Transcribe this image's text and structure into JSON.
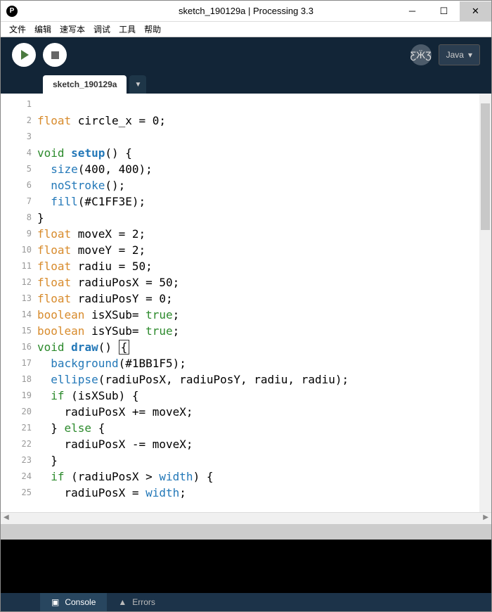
{
  "window": {
    "title": "sketch_190129a | Processing 3.3",
    "icon_letter": "P"
  },
  "menu": {
    "file": "文件",
    "edit": "编辑",
    "sketch": "速写本",
    "debug": "调试",
    "tools": "工具",
    "help": "帮助"
  },
  "toolbar": {
    "mode_label": "Java"
  },
  "tab": {
    "name": "sketch_190129a",
    "dropdown": "▼"
  },
  "code": {
    "lines": [
      {
        "n": 1,
        "segs": []
      },
      {
        "n": 2,
        "segs": [
          {
            "t": "float ",
            "c": "kw-type"
          },
          {
            "t": "circle_x = 0;"
          }
        ]
      },
      {
        "n": 3,
        "segs": []
      },
      {
        "n": 4,
        "segs": [
          {
            "t": "void ",
            "c": "kw-void"
          },
          {
            "t": "setup",
            "c": "fn-def"
          },
          {
            "t": "() {"
          }
        ]
      },
      {
        "n": 5,
        "segs": [
          {
            "t": "  "
          },
          {
            "t": "size",
            "c": "fn-call"
          },
          {
            "t": "(400, 400);"
          }
        ]
      },
      {
        "n": 6,
        "segs": [
          {
            "t": "  "
          },
          {
            "t": "noStroke",
            "c": "fn-call"
          },
          {
            "t": "();"
          }
        ]
      },
      {
        "n": 7,
        "segs": [
          {
            "t": "  "
          },
          {
            "t": "fill",
            "c": "fn-call"
          },
          {
            "t": "(#C1FF3E);"
          }
        ]
      },
      {
        "n": 8,
        "segs": [
          {
            "t": "}"
          }
        ]
      },
      {
        "n": 9,
        "segs": [
          {
            "t": "float ",
            "c": "kw-type"
          },
          {
            "t": "moveX = 2;"
          }
        ]
      },
      {
        "n": 10,
        "segs": [
          {
            "t": "float ",
            "c": "kw-type"
          },
          {
            "t": "moveY = 2;"
          }
        ]
      },
      {
        "n": 11,
        "segs": [
          {
            "t": "float ",
            "c": "kw-type"
          },
          {
            "t": "radiu = 50;"
          }
        ]
      },
      {
        "n": 12,
        "segs": [
          {
            "t": "float ",
            "c": "kw-type"
          },
          {
            "t": "radiuPosX = 50;"
          }
        ]
      },
      {
        "n": 13,
        "segs": [
          {
            "t": "float ",
            "c": "kw-type"
          },
          {
            "t": "radiuPosY = 0;"
          }
        ]
      },
      {
        "n": 14,
        "segs": [
          {
            "t": "boolean ",
            "c": "kw-type"
          },
          {
            "t": "isXSub= "
          },
          {
            "t": "true",
            "c": "const"
          },
          {
            "t": ";"
          }
        ]
      },
      {
        "n": 15,
        "segs": [
          {
            "t": "boolean ",
            "c": "kw-type"
          },
          {
            "t": "isYSub= "
          },
          {
            "t": "true",
            "c": "const"
          },
          {
            "t": ";"
          }
        ]
      },
      {
        "n": 16,
        "segs": [
          {
            "t": "void ",
            "c": "kw-void"
          },
          {
            "t": "draw",
            "c": "fn-def"
          },
          {
            "t": "() "
          },
          {
            "t": "{",
            "c": "cursor-box"
          }
        ]
      },
      {
        "n": 17,
        "segs": [
          {
            "t": "  "
          },
          {
            "t": "background",
            "c": "fn-call"
          },
          {
            "t": "(#1BB1F5);"
          }
        ]
      },
      {
        "n": 18,
        "segs": [
          {
            "t": "  "
          },
          {
            "t": "ellipse",
            "c": "fn-call"
          },
          {
            "t": "(radiuPosX, radiuPosY, radiu, radiu);"
          }
        ]
      },
      {
        "n": 19,
        "segs": [
          {
            "t": "  "
          },
          {
            "t": "if",
            "c": "kw-ctrl"
          },
          {
            "t": " (isXSub) {"
          }
        ]
      },
      {
        "n": 20,
        "segs": [
          {
            "t": "    radiuPosX += moveX;"
          }
        ]
      },
      {
        "n": 21,
        "segs": [
          {
            "t": "  } "
          },
          {
            "t": "else",
            "c": "kw-ctrl"
          },
          {
            "t": " {"
          }
        ]
      },
      {
        "n": 22,
        "segs": [
          {
            "t": "    radiuPosX -= moveX;"
          }
        ]
      },
      {
        "n": 23,
        "segs": [
          {
            "t": "  }"
          }
        ]
      },
      {
        "n": 24,
        "segs": [
          {
            "t": "  "
          },
          {
            "t": "if",
            "c": "kw-ctrl"
          },
          {
            "t": " (radiuPosX > "
          },
          {
            "t": "width",
            "c": "ident2"
          },
          {
            "t": ") {"
          }
        ]
      },
      {
        "n": 25,
        "segs": [
          {
            "t": "    radiuPosX = "
          },
          {
            "t": "width",
            "c": "ident2"
          },
          {
            "t": ";"
          }
        ]
      }
    ]
  },
  "bottom": {
    "console": "Console",
    "errors": "Errors"
  }
}
